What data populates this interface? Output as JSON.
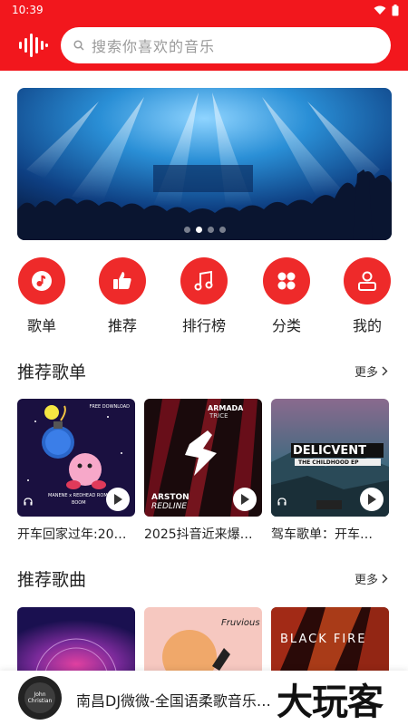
{
  "status": {
    "time": "10:39"
  },
  "search": {
    "placeholder": "搜索你喜欢的音乐"
  },
  "banner": {
    "page_count": 4,
    "active_index": 1
  },
  "nav": [
    {
      "label": "歌单",
      "icon": "music-note-icon"
    },
    {
      "label": "推荐",
      "icon": "thumbs-up-icon"
    },
    {
      "label": "排行榜",
      "icon": "music-notes-icon"
    },
    {
      "label": "分类",
      "icon": "category-icon"
    },
    {
      "label": "我的",
      "icon": "user-icon"
    }
  ],
  "playlists": {
    "title": "推荐歌单",
    "more": "更多",
    "items": [
      {
        "title": "开车回家过年:20…",
        "cover_lines": [
          "FREE DOWNLOAD",
          "MANENE x REDHEAD ROMANCE",
          "BOOM"
        ]
      },
      {
        "title": "2025抖音近来爆…",
        "cover_lines": [
          "ARMADA",
          "TRICE",
          "ARSTON",
          "REDLINE"
        ]
      },
      {
        "title": "驾车歌单：开车…",
        "cover_lines": [
          "DELICVENT",
          "THE CHILDHOOD EP"
        ]
      }
    ]
  },
  "songs": {
    "title": "推荐歌曲",
    "more": "更多",
    "items": [
      {
        "cover_lines": []
      },
      {
        "cover_lines": [
          "Fruvious"
        ]
      },
      {
        "cover_lines": [
          "BLACK FIRE"
        ]
      }
    ]
  },
  "player": {
    "title": "南昌DJ微微-全国语柔歌音乐…",
    "disc_label": "John Christian"
  },
  "watermark": "大玩客",
  "colors": {
    "brand": "#f2171d",
    "accent": "#ee2a2a"
  }
}
